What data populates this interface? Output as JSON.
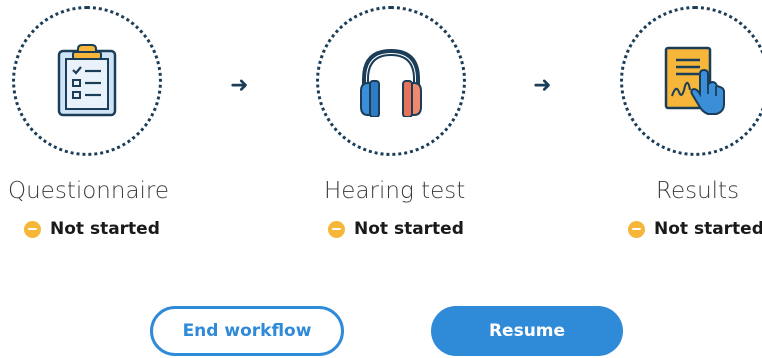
{
  "steps": [
    {
      "title": "Questionnaire",
      "status": "Not started",
      "icon": "clipboard-checklist-icon"
    },
    {
      "title": "Hearing test",
      "status": "Not started",
      "icon": "headphones-icon"
    },
    {
      "title": "Results",
      "status": "Not started",
      "icon": "signed-document-icon"
    }
  ],
  "buttons": {
    "end_workflow": "End workflow",
    "resume": "Resume"
  },
  "colors": {
    "accent": "#2f8ad8",
    "dotted_border": "#1b3d58",
    "status_pending": "#f5b63a"
  }
}
